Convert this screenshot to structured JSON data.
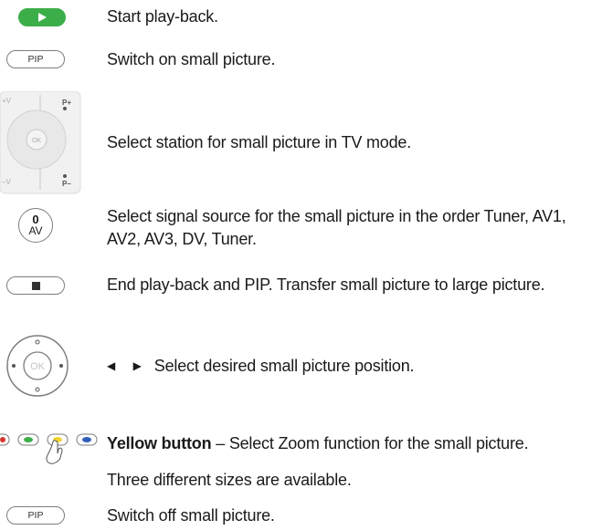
{
  "rows": [
    {
      "text": "Start play-back.",
      "button_icon": "play-icon"
    },
    {
      "text": "Switch on small picture.",
      "button_label": "PIP"
    },
    {
      "text": "Select station for small picture in TV mode.",
      "pad_labels": {
        "ok": "OK",
        "vplus": "+V",
        "vminus": "–V",
        "pplus": "P+",
        "pminus": "P–"
      }
    },
    {
      "text": "Select signal source for the small picture in the order Tuner, AV1, AV2, AV3, DV, Tuner.",
      "button_top": "0",
      "button_bottom": "AV"
    },
    {
      "text": "End play-back and PIP. Transfer small picture to large picture.",
      "button_icon": "stop-icon"
    },
    {
      "text": "Select desired small picture position.",
      "arrows": "◀ ▶",
      "nav_label": "OK"
    },
    {
      "bold": "Yellow button",
      "text": " – Select Zoom function for the small picture.",
      "colors": {
        "red": "#d9342b",
        "green": "#3cae49",
        "yellow": "#f2d230",
        "blue": "#2f5fb8"
      }
    },
    {
      "text": "Three different sizes are available."
    },
    {
      "text": "Switch off small picture.",
      "button_label": "PIP"
    }
  ]
}
